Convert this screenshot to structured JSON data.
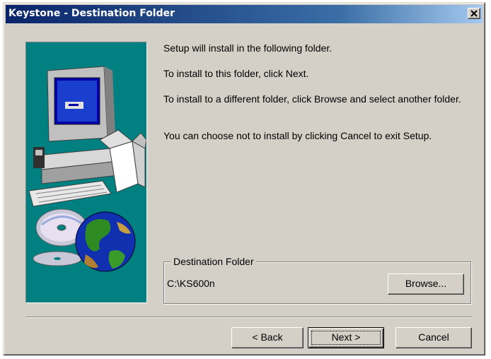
{
  "window": {
    "title": "Keystone - Destination Folder",
    "close_glyph": "×"
  },
  "messages": [
    "Setup will install  in the following folder.",
    "To install to this folder, click Next.",
    "To install to a different folder, click Browse and select another folder.",
    "You can choose not to install  by clicking Cancel to exit Setup."
  ],
  "destination": {
    "legend": "Destination Folder",
    "path": "C:\\KS600n",
    "browse_label": "Browse..."
  },
  "buttons": {
    "back_label": "< Back",
    "next_label": "Next >",
    "cancel_label": "Cancel"
  },
  "art": {
    "icons": [
      "computer-icon",
      "cd-disc-icon",
      "globe-icon",
      "open-box-icon"
    ],
    "background_color": "#008080"
  }
}
